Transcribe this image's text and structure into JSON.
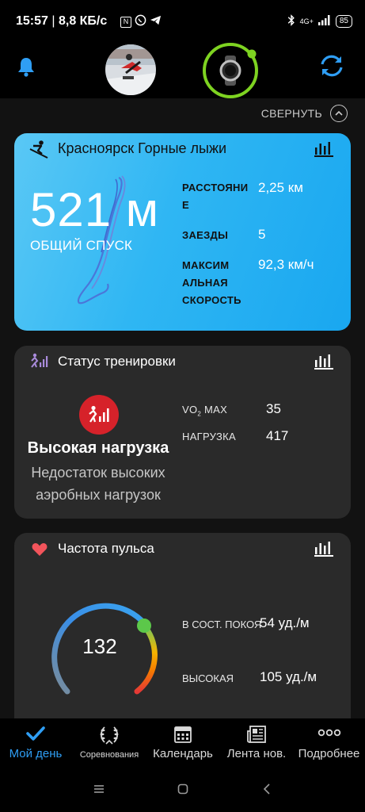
{
  "status_bar": {
    "time": "15:57",
    "speed": "8,8 КБ/с",
    "network": "4G+",
    "battery": "85"
  },
  "header": {
    "bell_icon": "bell-icon",
    "avatar": "user-avatar",
    "device": "watch-icon",
    "sync_icon": "sync-icon"
  },
  "collapse": {
    "label": "СВЕРНУТЬ"
  },
  "ski_card": {
    "title": "Красноярск Горные лыжи",
    "big_value": "521 м",
    "big_label": "ОБЩИЙ СПУСК",
    "metrics": [
      {
        "label_line1": "РАССТОЯНИ",
        "label_line2": "Е",
        "value": "2,25 км"
      },
      {
        "label_line1": "ЗАЕЗДЫ",
        "value": "5"
      },
      {
        "label_line1": "МАКСИМ",
        "label_line2": "АЛЬНАЯ",
        "label_line3": "СКОРОСТЬ",
        "value": "92,3 км/ч"
      }
    ]
  },
  "training_card": {
    "title": "Статус тренировки",
    "status": "Высокая нагрузка",
    "sub_line1": "Недостаток высоких",
    "sub_line2": "аэробных нагрузок",
    "vo2_label": "VO",
    "vo2_sub": "2",
    "vo2_suffix": " MAX",
    "vo2_value": "35",
    "load_label": "НАГРУЗКА",
    "load_value": "417"
  },
  "hr_card": {
    "title": "Частота пульса",
    "current": "132",
    "rest_label": "В СОСТ. ПОКОЯ",
    "rest_value": "54 уд./м",
    "high_label": "ВЫСОКАЯ",
    "high_value": "105 уд./м"
  },
  "bottom_nav": {
    "items": [
      {
        "label": "Мой день",
        "icon": "check-icon"
      },
      {
        "label": "Соревнования",
        "icon": "laurel-icon"
      },
      {
        "label": "Календарь",
        "icon": "calendar-icon"
      },
      {
        "label": "Лента нов.",
        "icon": "newsfeed-icon"
      },
      {
        "label": "Подробнее",
        "icon": "more-icon"
      }
    ]
  },
  "colors": {
    "accent": "#2f9ef4",
    "ski_card": "#2fb6f3",
    "card": "#2a2a2a",
    "alert": "#d6222a",
    "ring_green": "#7ed321"
  }
}
